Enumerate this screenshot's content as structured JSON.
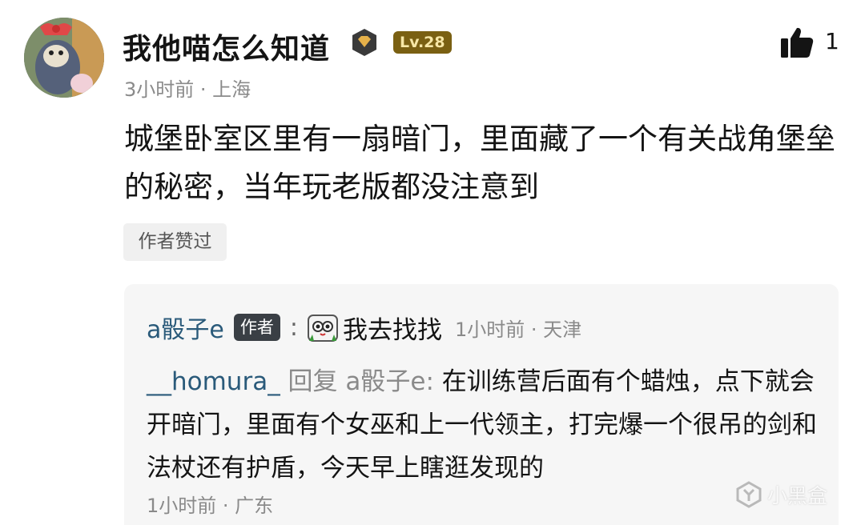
{
  "comment": {
    "username": "我他喵怎么知道",
    "level": "Lv.28",
    "like_count": "1",
    "meta": "3小时前 · 上海",
    "text": "城堡卧室区里有一扇暗门，里面藏了一个有关战角堡垒的秘密，当年玩老版都没注意到",
    "author_liked_tag": "作者赞过"
  },
  "replies": [
    {
      "name": "a骰子e",
      "author_tag": "作者",
      "colon": ":",
      "text": "我去找找",
      "time": "1小时前 · 天津"
    },
    {
      "name": "__homura_",
      "reply_prefix": " 回复 a骰子e: ",
      "text": "在训练营后面有个蜡烛，点下就会开暗门，里面有个女巫和上一代领主，打完爆一个很吊的剑和法杖还有护盾，今天早上瞎逛发现的",
      "time": "1小时前 · 广东"
    }
  ],
  "watermark": "小黑盒",
  "colors": {
    "level_badge_bg": "#7a6012",
    "reply_name": "#2a5a7a",
    "meta_gray": "#8a8a8a"
  }
}
